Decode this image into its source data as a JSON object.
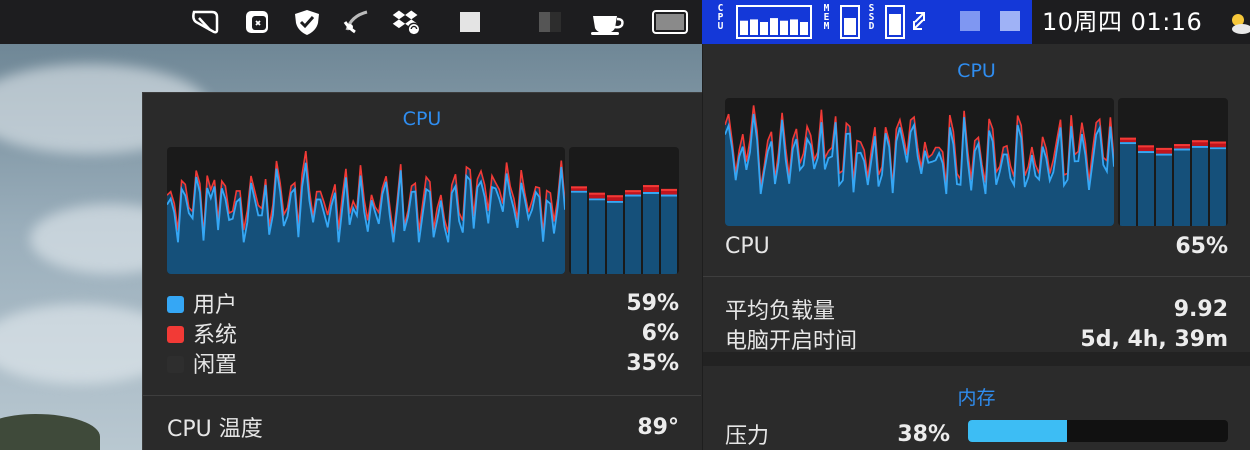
{
  "menubar": {
    "icons": [
      "bridge-icon",
      "screenshot-icon",
      "vpn-shield-icon",
      "satellite-icon",
      "dropbox-sync-icon",
      "blank-icon",
      "blank-icon",
      "coffee-cup-icon",
      "window-icon"
    ],
    "istat": {
      "cpu_label": "CPU",
      "mem_label": "MEM",
      "ssd_label": "SSD",
      "cpu_bars": [
        0.55,
        0.6,
        0.5,
        0.65,
        0.55,
        0.6,
        0.5
      ],
      "mem_level": 0.65,
      "ssd_level": 0.8
    },
    "clock": "10周四 01:16",
    "weather_icon": "partly-sunny-icon"
  },
  "left_panel": {
    "title": "CPU",
    "legend": [
      {
        "label": "用户",
        "value": "59%",
        "color": "#35a7f5"
      },
      {
        "label": "系统",
        "value": "6%",
        "color": "#f23a36"
      },
      {
        "label": "闲置",
        "value": "35%",
        "color": "#2e2e2e"
      }
    ],
    "temp_label": "CPU 温度",
    "temp_value": "89°",
    "core_bars": [
      {
        "user": 0.64,
        "system": 0.05
      },
      {
        "user": 0.58,
        "system": 0.06
      },
      {
        "user": 0.56,
        "system": 0.06
      },
      {
        "user": 0.61,
        "system": 0.05
      },
      {
        "user": 0.63,
        "system": 0.07
      },
      {
        "user": 0.61,
        "system": 0.06
      }
    ]
  },
  "right_panel": {
    "cpu_title": "CPU",
    "cpu_label": "CPU",
    "cpu_value": "65%",
    "load_label": "平均负载量",
    "load_value": "9.92",
    "uptime_label": "电脑开启时间",
    "uptime_value": "5d, 4h, 39m",
    "mem_title": "内存",
    "pressure_label": "压力",
    "pressure_value": "38%",
    "pressure_level": 0.38,
    "core_bars": [
      {
        "user": 0.64,
        "system": 0.05
      },
      {
        "user": 0.57,
        "system": 0.06
      },
      {
        "user": 0.55,
        "system": 0.06
      },
      {
        "user": 0.59,
        "system": 0.05
      },
      {
        "user": 0.61,
        "system": 0.06
      },
      {
        "user": 0.6,
        "system": 0.06
      }
    ]
  },
  "colors": {
    "user": "#35a7f5",
    "system": "#f23a36",
    "fill": "#15507a",
    "accent": "#2f8df0"
  }
}
